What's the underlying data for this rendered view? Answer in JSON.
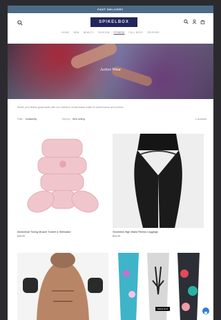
{
  "announcement": "FAST DELIVERY",
  "header": {
    "logo": "SPIKELBOX",
    "nav": [
      "HOME",
      "NEW",
      "BEAUTY",
      "FASHION",
      "FITNESS",
      "FULL BODY",
      "REVIEWS"
    ],
    "active_nav_index": 4
  },
  "hero": {
    "title": "Active Wear"
  },
  "description": "Reach your fitness goals faster with our collection of activewear made for performance and comfort.",
  "filters": {
    "filter_label": "Filter:",
    "filter_value": "Availability",
    "sort_label": "Sort by:",
    "sort_value": "Best selling",
    "count": "4 products"
  },
  "products": [
    {
      "title": "Abdominal Toning Muscle Trainer & Stimulator",
      "price": "$49.99"
    },
    {
      "title": "Seamless High Waist Fitness Leggings",
      "price": "$34.99"
    },
    {
      "title": "",
      "price": ""
    },
    {
      "title": "",
      "price": "",
      "badge": "SOLD OUT"
    }
  ],
  "colors": {
    "announcement": "#4b6b87",
    "logo_bg": "#20255a",
    "accent": "#2a7de1"
  }
}
